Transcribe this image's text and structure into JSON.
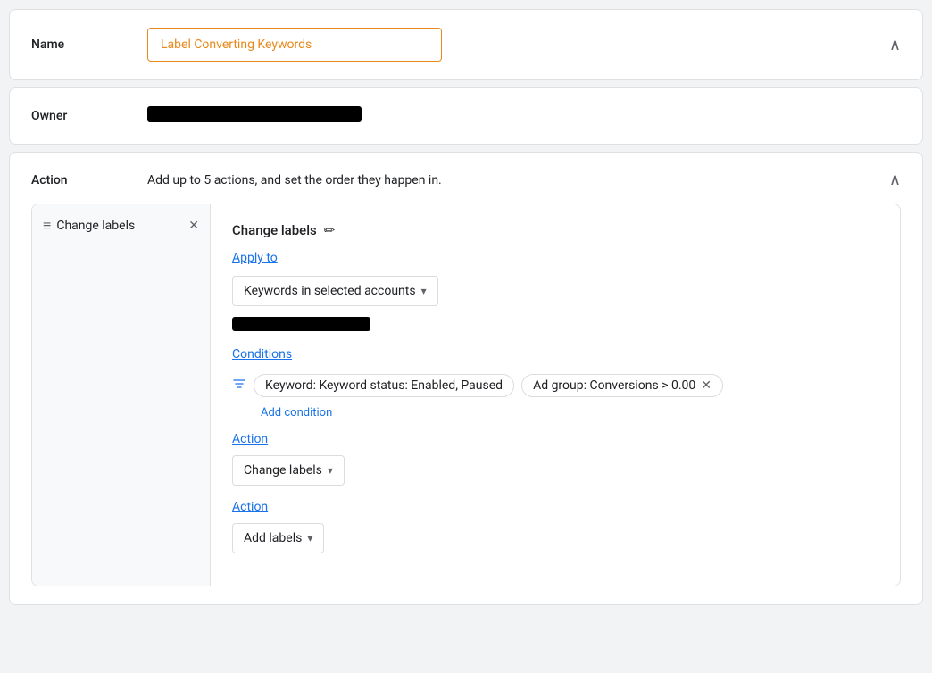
{
  "name_section": {
    "label": "Name",
    "input_value": "Label Converting Keywords",
    "input_placeholder": "Label Converting Keywords"
  },
  "owner_section": {
    "label": "Owner"
  },
  "action_section": {
    "label": "Action",
    "description": "Add up to 5 actions, and set the order they happen in.",
    "sidebar_label": "Change labels",
    "detail": {
      "title": "Change labels",
      "apply_to_label": "Apply to",
      "apply_to_value": "Keywords in selected accounts",
      "conditions_label": "Conditions",
      "condition_1": "Keyword: Keyword status: Enabled, Paused",
      "condition_2": "Ad group: Conversions > 0.00",
      "add_condition": "Add condition",
      "action_label_1": "Action",
      "action_btn_1": "Change labels",
      "action_label_2": "Action",
      "action_btn_2": "Add labels"
    }
  },
  "icons": {
    "chevron_up": "∧",
    "chevron_down": "▾",
    "drag": "≡",
    "close": "✕",
    "edit": "✏",
    "filter": "▼",
    "remove": "✕"
  }
}
